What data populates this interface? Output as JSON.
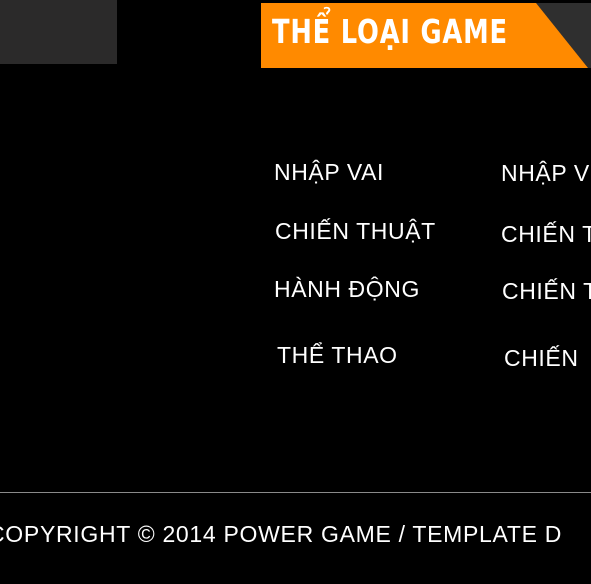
{
  "header": {
    "title": "THỂ LOẠI GAME"
  },
  "genres": {
    "left": [
      {
        "label": "NHẬP VAI"
      },
      {
        "label": "CHIẾN THUẬT"
      },
      {
        "label": "HÀNH ĐỘNG"
      },
      {
        "label": "THỂ THAO"
      }
    ],
    "right": [
      {
        "label": "NHẬP V"
      },
      {
        "label": "CHIẾN T"
      },
      {
        "label": "CHIẾN T"
      },
      {
        "label": "CHIẾN"
      }
    ]
  },
  "footer": {
    "copyright": "COPYRIGHT © 2014 POWER GAME / TEMPLATE D"
  },
  "colors": {
    "background": "#000000",
    "accent": "#ff8a00",
    "dark_block": "#2b2a2a",
    "text": "#ffffff",
    "divider": "#8a8a8a"
  }
}
